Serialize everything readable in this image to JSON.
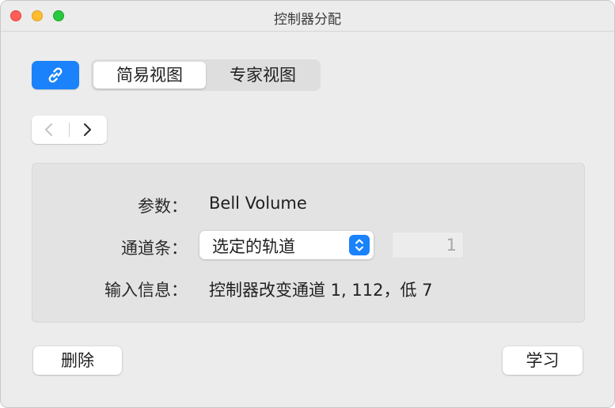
{
  "window": {
    "title": "控制器分配"
  },
  "toolbar": {
    "link_icon": "link-icon",
    "view_tabs": [
      {
        "label": "简易视图",
        "selected": true
      },
      {
        "label": "专家视图",
        "selected": false
      }
    ]
  },
  "navigation": {
    "prev_icon": "chevron-left-icon",
    "next_icon": "chevron-right-icon"
  },
  "details": {
    "parameter_label": "参数：",
    "parameter_value": "Bell Volume",
    "channel_label": "通道条：",
    "channel_selected": "选定的轨道",
    "channel_number": "1",
    "input_label": "输入信息：",
    "input_value": "控制器改变通道 1, 112，低 7"
  },
  "buttons": {
    "delete_label": "删除",
    "learn_label": "学习"
  },
  "colors": {
    "accent": "#1a82fb",
    "close": "#ff5f57",
    "minimize": "#febc2e",
    "maximize": "#28c840"
  }
}
